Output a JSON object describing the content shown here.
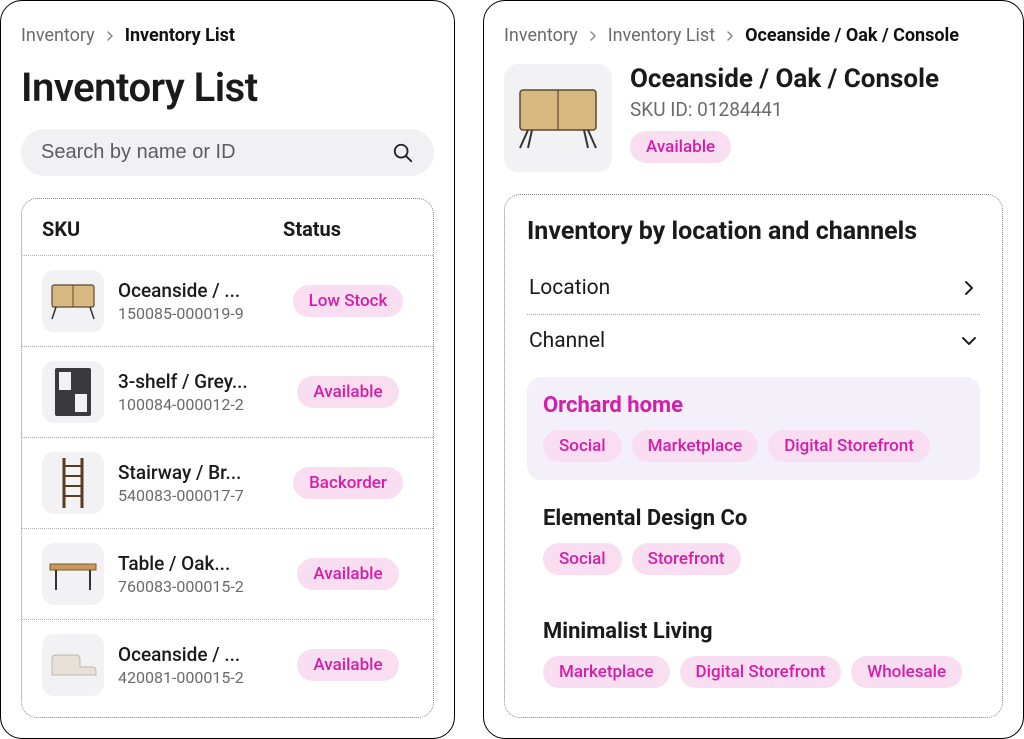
{
  "colors": {
    "accent": "#d41ea8",
    "pillBg": "#f9def1"
  },
  "left": {
    "breadcrumb": [
      {
        "label": "Inventory",
        "current": false
      },
      {
        "label": "Inventory List",
        "current": true
      }
    ],
    "title": "Inventory List",
    "search": {
      "placeholder": "Search by name or ID"
    },
    "columns": {
      "sku": "SKU",
      "status": "Status"
    },
    "rows": [
      {
        "name": "Oceanside / ...",
        "sku": "150085-000019-9",
        "status": "Low Stock",
        "icon": "credenza"
      },
      {
        "name": "3-shelf / Grey...",
        "sku": "100084-000012-2",
        "status": "Available",
        "icon": "shelf"
      },
      {
        "name": "Stairway / Br...",
        "sku": "540083-000017-7",
        "status": "Backorder",
        "icon": "ladder"
      },
      {
        "name": "Table / Oak...",
        "sku": "760083-000015-2",
        "status": "Available",
        "icon": "table"
      },
      {
        "name": "Oceanside / ...",
        "sku": "420081-000015-2",
        "status": "Available",
        "icon": "sofa"
      }
    ]
  },
  "right": {
    "breadcrumb": [
      {
        "label": "Inventory",
        "current": false
      },
      {
        "label": "Inventory List",
        "current": false
      },
      {
        "label": "Oceanside / Oak / Console",
        "current": true
      }
    ],
    "product": {
      "title": "Oceanside / Oak / Console",
      "skuLabel": "SKU ID: 01284441",
      "status": "Available"
    },
    "section": {
      "title": "Inventory by location and channels",
      "location": "Location",
      "channel": "Channel",
      "channels": [
        {
          "name": "Orchard home",
          "active": true,
          "chips": [
            "Social",
            "Marketplace",
            "Digital Storefront"
          ]
        },
        {
          "name": "Elemental Design Co",
          "active": false,
          "chips": [
            "Social",
            "Storefront"
          ]
        },
        {
          "name": "Minimalist Living",
          "active": false,
          "chips": [
            "Marketplace",
            "Digital Storefront",
            "Wholesale"
          ]
        }
      ]
    }
  }
}
